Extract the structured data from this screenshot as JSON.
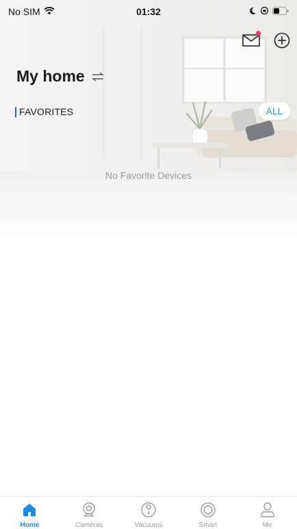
{
  "status_bar": {
    "carrier": "No SIM",
    "time": "01:32",
    "icons": [
      "wifi-icon",
      "moon-icon",
      "orientation-lock-icon",
      "battery-icon"
    ]
  },
  "header": {
    "title": "My home",
    "mail_has_unread": true,
    "icons": [
      "mail-icon",
      "add-icon",
      "switch-home-icon"
    ]
  },
  "favorites": {
    "section_label": "FAVORITES",
    "all_label": "ALL",
    "empty_text": "No Favorite Devices"
  },
  "tabs": [
    {
      "label": "Home",
      "icon": "home-icon",
      "active": true
    },
    {
      "label": "Cameras",
      "icon": "camera-icon",
      "active": false
    },
    {
      "label": "Vacuums",
      "icon": "vacuum-icon",
      "active": false
    },
    {
      "label": "Smart",
      "icon": "smart-icon",
      "active": false
    },
    {
      "label": "Me",
      "icon": "person-icon",
      "active": false
    }
  ],
  "colors": {
    "accent": "#1e88e5",
    "section_bar": "#2f5bd8",
    "badge": "#f23a5d",
    "inactive": "#9a9a9a"
  }
}
